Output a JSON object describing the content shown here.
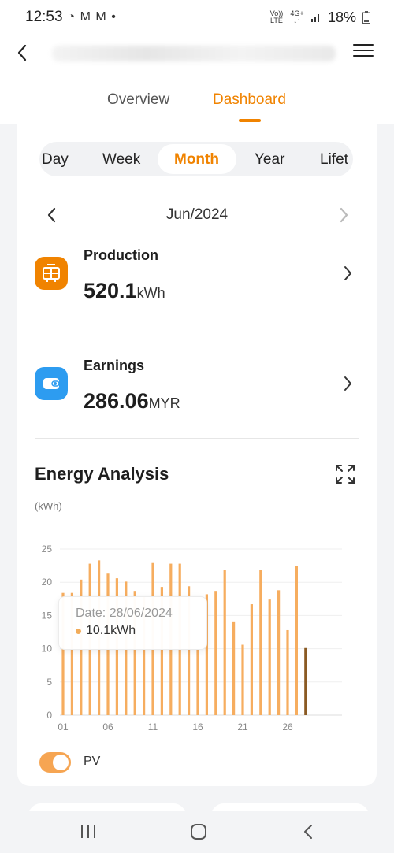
{
  "status": {
    "time": "12:53",
    "notif_icons": "◔ M M •",
    "net_volte": "Vo)) LTE",
    "net_4g": "4G+ ↓↑",
    "battery": "18%"
  },
  "header": {
    "tabs": [
      {
        "label": "Overview"
      },
      {
        "label": "Dashboard"
      }
    ],
    "active_tab": "Dashboard"
  },
  "periods": [
    {
      "label": "Day"
    },
    {
      "label": "Week"
    },
    {
      "label": "Month"
    },
    {
      "label": "Year"
    },
    {
      "label": "Lifet"
    }
  ],
  "selected_period": "Month",
  "date_label": "Jun/2024",
  "production": {
    "label": "Production",
    "value": "520.1",
    "unit": "kWh"
  },
  "earnings": {
    "label": "Earnings",
    "value": "286.06",
    "unit": "MYR"
  },
  "energy_analysis": {
    "title": "Energy Analysis",
    "unit_label": "(kWh)"
  },
  "tooltip": {
    "date": "Date: 28/06/2024",
    "value": "10.1kWh"
  },
  "legend": {
    "label": "PV"
  },
  "colors": {
    "accent": "#f08300",
    "bar": "#f6ad5f",
    "bar_selected": "#8a5a23",
    "earnings_icon": "#2d9cf0"
  },
  "chart_data": {
    "type": "bar",
    "x": [
      1,
      2,
      3,
      4,
      5,
      6,
      7,
      8,
      9,
      10,
      11,
      12,
      13,
      14,
      15,
      16,
      17,
      18,
      19,
      20,
      21,
      22,
      23,
      24,
      25,
      26,
      27,
      28
    ],
    "values": [
      18.4,
      18.4,
      20.4,
      22.8,
      23.3,
      21.3,
      20.6,
      20.1,
      18.7,
      17.8,
      22.9,
      19.3,
      22.8,
      22.8,
      19.4,
      9.9,
      18.2,
      18.7,
      21.8,
      14.0,
      10.6,
      16.7,
      21.8,
      17.4,
      18.8,
      12.8,
      22.5,
      10.1
    ],
    "selected_day": 28,
    "series": [
      {
        "name": "PV"
      }
    ],
    "ylabel": "(kWh)",
    "ylim": [
      0,
      25
    ],
    "yticks": [
      "0",
      "5",
      "10",
      "15",
      "20",
      "25"
    ],
    "xticks": [
      {
        "day": 1,
        "label": "01"
      },
      {
        "day": 6,
        "label": "06"
      },
      {
        "day": 11,
        "label": "11"
      },
      {
        "day": 16,
        "label": "16"
      },
      {
        "day": 21,
        "label": "21"
      },
      {
        "day": 26,
        "label": "26"
      }
    ],
    "grid": true
  }
}
